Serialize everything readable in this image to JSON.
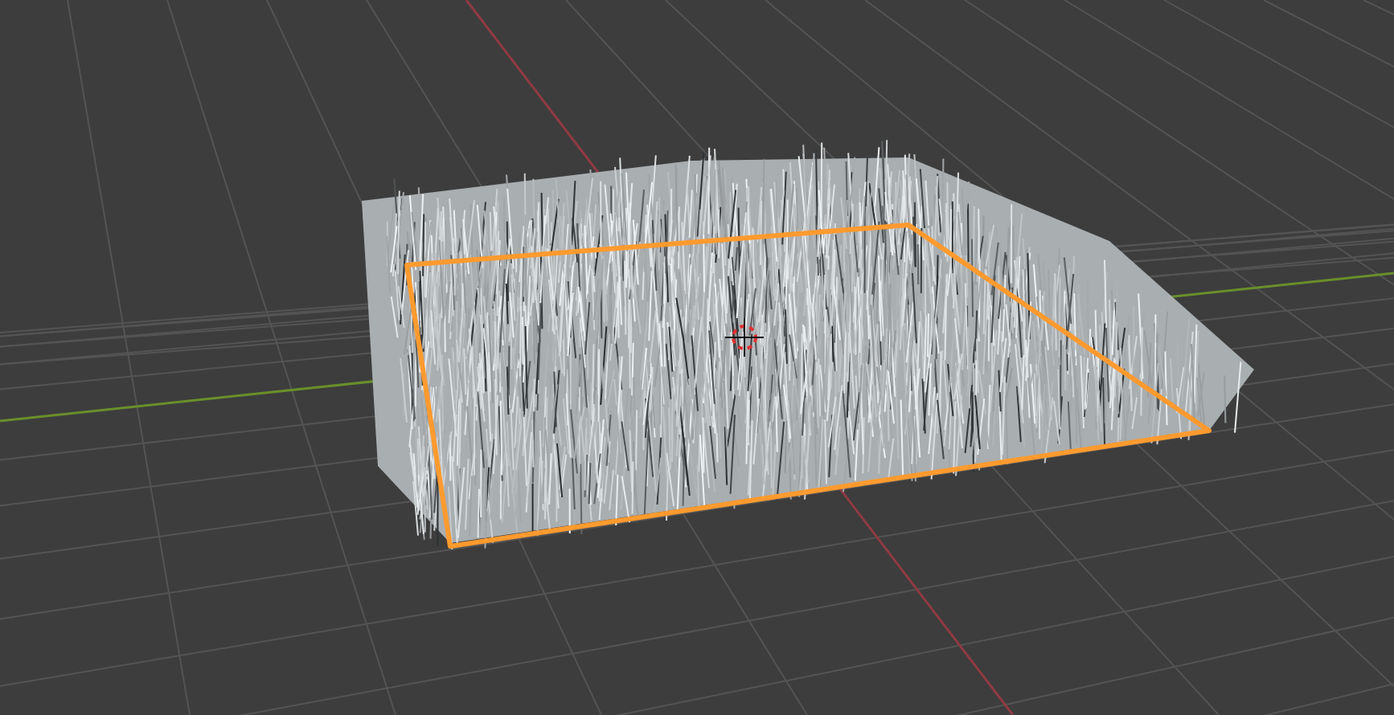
{
  "viewport": {
    "kind": "perspective",
    "object": {
      "kind": "grass",
      "selected": true
    },
    "cursor": {
      "kind": "crosshair"
    }
  }
}
